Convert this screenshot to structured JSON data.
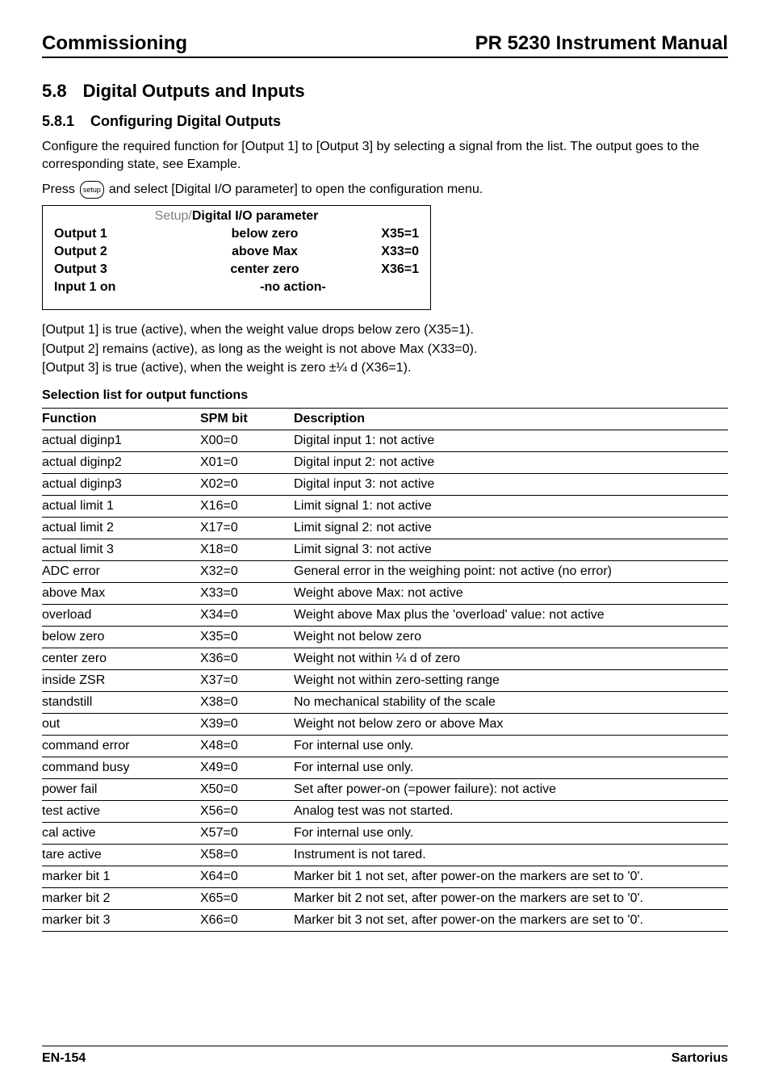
{
  "header": {
    "left": "Commissioning",
    "right": "PR 5230 Instrument Manual"
  },
  "section": {
    "number": "5.8",
    "title": "Digital Outputs and Inputs"
  },
  "subsection": {
    "number": "5.8.1",
    "title": "Configuring Digital Outputs"
  },
  "intro": "Configure the required function for [Output 1] to [Output 3] by selecting a signal from the list. The output goes to the corresponding state, see Example.",
  "press": {
    "prefix": "Press",
    "icon_label": "setup",
    "suffix": "and select [Digital I/O parameter] to open the configuration menu."
  },
  "param_box": {
    "title_gray": "Setup/",
    "title_bold": "Digital I/O parameter",
    "rows": [
      {
        "label": "Output 1",
        "value": "below zero",
        "code": "X35=1"
      },
      {
        "label": "Output 2",
        "value": "above Max",
        "code": "X33=0"
      },
      {
        "label": "Output 3",
        "value": "center zero",
        "code": "X36=1"
      }
    ],
    "input_row": {
      "label": "Input 1 on",
      "value": "-no action-"
    }
  },
  "output_notes": [
    "[Output 1] is true (active), when the weight value drops below zero (X35=1).",
    "[Output 2] remains (active), as long as the weight is not above Max (X33=0).",
    "[Output 3] is true (active), when the weight is zero ±¼ d (X36=1)."
  ],
  "selection_heading": "Selection list for output functions",
  "table": {
    "headers": {
      "fn": "Function",
      "spm": "SPM bit",
      "desc": "Description"
    },
    "rows": [
      {
        "fn": "actual diginp1",
        "spm": "X00=0",
        "desc": "Digital input 1: not active"
      },
      {
        "fn": "actual diginp2",
        "spm": "X01=0",
        "desc": "Digital input 2: not active"
      },
      {
        "fn": "actual diginp3",
        "spm": "X02=0",
        "desc": "Digital input 3: not active"
      },
      {
        "fn": "actual limit 1",
        "spm": "X16=0",
        "desc": "Limit signal 1: not active"
      },
      {
        "fn": "actual limit 2",
        "spm": "X17=0",
        "desc": "Limit signal 2: not active"
      },
      {
        "fn": "actual limit 3",
        "spm": "X18=0",
        "desc": "Limit signal 3: not active"
      },
      {
        "fn": "ADC error",
        "spm": "X32=0",
        "desc": "General error in the weighing point: not active (no error)"
      },
      {
        "fn": "above Max",
        "spm": "X33=0",
        "desc": "Weight above Max: not active"
      },
      {
        "fn": "overload",
        "spm": "X34=0",
        "desc": "Weight above Max plus the 'overload' value: not active"
      },
      {
        "fn": "below zero",
        "spm": "X35=0",
        "desc": "Weight not below zero"
      },
      {
        "fn": "center zero",
        "spm": "X36=0",
        "desc": "Weight not within ¼ d of zero"
      },
      {
        "fn": "inside ZSR",
        "spm": "X37=0",
        "desc": "Weight not within zero-setting range"
      },
      {
        "fn": "standstill",
        "spm": "X38=0",
        "desc": "No mechanical stability of the scale"
      },
      {
        "fn": "out",
        "spm": "X39=0",
        "desc": "Weight not below zero or above Max"
      },
      {
        "fn": "command error",
        "spm": "X48=0",
        "desc": "For internal use only."
      },
      {
        "fn": "command busy",
        "spm": "X49=0",
        "desc": "For internal use only."
      },
      {
        "fn": "power fail",
        "spm": "X50=0",
        "desc": "Set after power-on (=power failure): not active"
      },
      {
        "fn": "test active",
        "spm": "X56=0",
        "desc": "Analog test was not started."
      },
      {
        "fn": "cal active",
        "spm": "X57=0",
        "desc": "For internal use only."
      },
      {
        "fn": "tare active",
        "spm": "X58=0",
        "desc": "Instrument is not tared."
      },
      {
        "fn": "marker bit 1",
        "spm": "X64=0",
        "desc": "Marker bit 1 not set, after power-on the markers are set to '0'."
      },
      {
        "fn": "marker bit 2",
        "spm": "X65=0",
        "desc": "Marker bit 2 not set, after power-on the markers are set to '0'."
      },
      {
        "fn": "marker bit 3",
        "spm": "X66=0",
        "desc": "Marker bit 3 not set, after power-on the markers are set to '0'."
      }
    ]
  },
  "footer": {
    "left": "EN-154",
    "right": "Sartorius"
  }
}
